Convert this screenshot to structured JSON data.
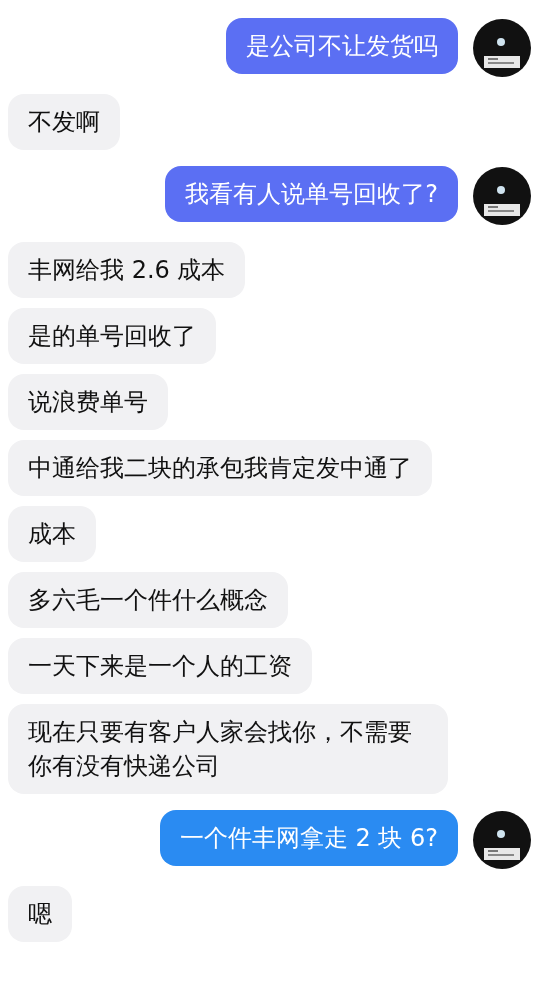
{
  "messages": [
    {
      "kind": "outgoing",
      "text": "是公司不让发货吗",
      "color": "#5b6ff3"
    },
    {
      "kind": "incoming",
      "text": "不发啊"
    },
    {
      "kind": "outgoing",
      "text": "我看有人说单号回收了?",
      "color": "#5b6ff3"
    },
    {
      "kind": "incoming",
      "text": "丰网给我 2.6 成本"
    },
    {
      "kind": "incoming",
      "text": "是的单号回收了"
    },
    {
      "kind": "incoming",
      "text": "说浪费单号"
    },
    {
      "kind": "incoming",
      "text": "中通给我二块的承包我肯定发中通了"
    },
    {
      "kind": "incoming",
      "text": "成本"
    },
    {
      "kind": "incoming",
      "text": "多六毛一个件什么概念"
    },
    {
      "kind": "incoming",
      "text": "一天下来是一个人的工资"
    },
    {
      "kind": "incoming",
      "text": "现在只要有客户人家会找你，不需要你有没有快递公司"
    },
    {
      "kind": "outgoing",
      "text": "一个件丰网拿走 2 块 6?",
      "color": "#2a8bf2"
    },
    {
      "kind": "incoming",
      "text": "嗯"
    }
  ]
}
